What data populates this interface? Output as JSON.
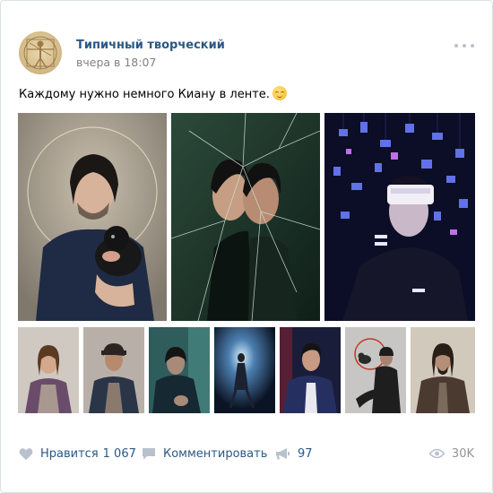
{
  "post": {
    "author": "Типичный творческий",
    "time": "вчера в 18:07",
    "text": "Каждому нужно немного Киану в ленте.",
    "emoji_icon": "relieved-face-emoji"
  },
  "photos": {
    "large": [
      {
        "name": "photo-keanu-with-puppy"
      },
      {
        "name": "photo-keanu-shattered-mirror"
      },
      {
        "name": "photo-keanu-neon-cyberpunk"
      }
    ],
    "small": [
      {
        "name": "photo-thumb-1"
      },
      {
        "name": "photo-thumb-2"
      },
      {
        "name": "photo-thumb-3"
      },
      {
        "name": "photo-thumb-4"
      },
      {
        "name": "photo-thumb-5"
      },
      {
        "name": "photo-thumb-6"
      },
      {
        "name": "photo-thumb-7"
      }
    ]
  },
  "footer": {
    "like_label": "Нравится",
    "like_count": "1 067",
    "comment_label": "Комментировать",
    "share_count": "97",
    "views_count": "30K"
  },
  "colors": {
    "link": "#2a5885",
    "muted": "#828282",
    "icon": "#b8c1cc"
  }
}
